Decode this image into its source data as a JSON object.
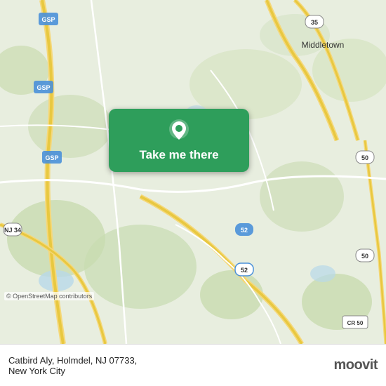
{
  "map": {
    "background_color": "#e4edd8",
    "center_lat": 40.38,
    "center_lon": -74.18
  },
  "button": {
    "label": "Take me there",
    "bg_color": "#2e9e5b"
  },
  "footer": {
    "address": "Catbird Aly, Holmdel, NJ 07733,",
    "city": "New York City"
  },
  "osm_credit": "© OpenStreetMap contributors",
  "moovit": {
    "label": "moovit"
  }
}
